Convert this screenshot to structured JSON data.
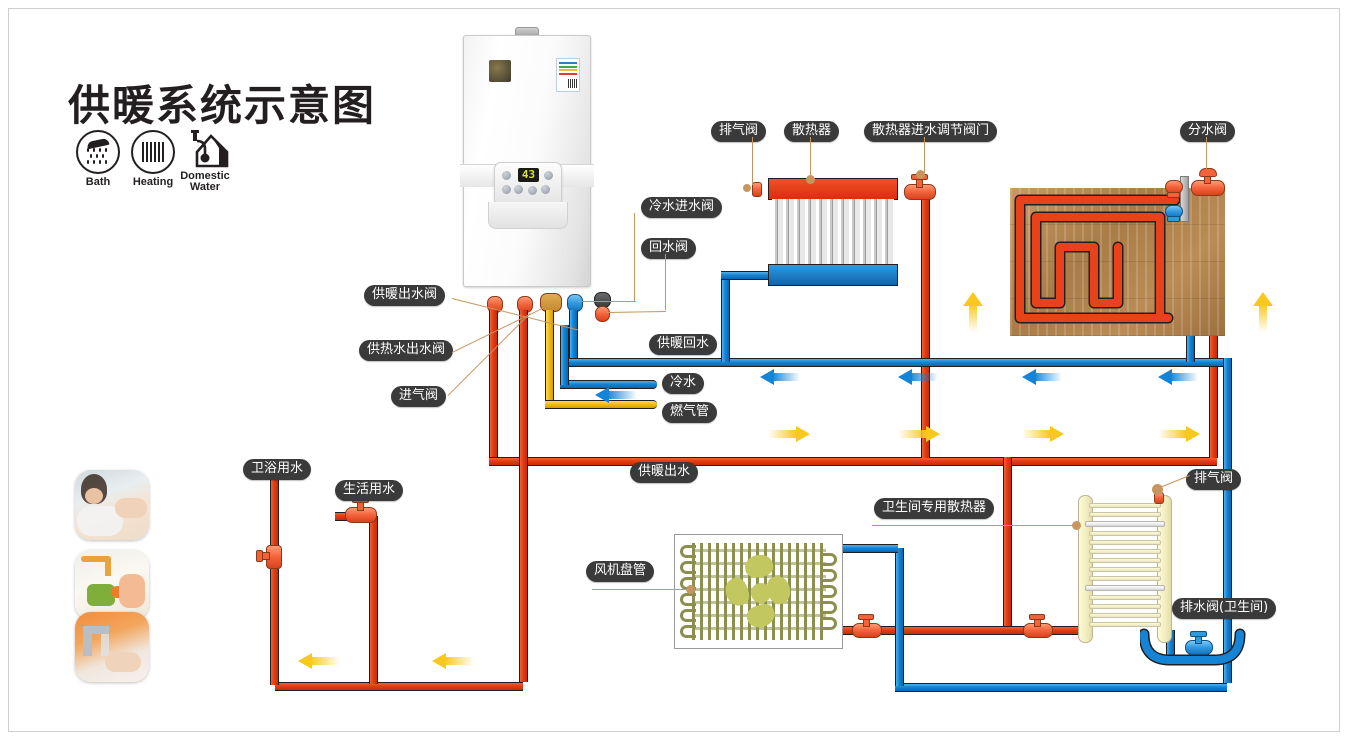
{
  "page": {
    "title": "供暖系统示意图"
  },
  "legend": {
    "items": [
      {
        "icon": "shower-icon",
        "label": "Bath"
      },
      {
        "icon": "radiator-icon",
        "label": "Heating"
      },
      {
        "icon": "house-tap-icon",
        "label": "Domestic\nWater",
        "line1": "Domestic",
        "line2": "Water"
      }
    ]
  },
  "photos": [
    {
      "name": "photo-bathing",
      "alt": "bathing"
    },
    {
      "name": "photo-washing-vegetables",
      "alt": "washing vegetables"
    },
    {
      "name": "photo-washing-hands",
      "alt": "washing hands"
    }
  ],
  "boiler": {
    "name": "wall-hung-gas-boiler",
    "display_value": "43"
  },
  "labels": {
    "cold_water_inlet_valve": "冷水进水阀",
    "return_water_valve": "回水阀",
    "heating_outlet_valve": "供暖出水阀",
    "hot_water_outlet_valve": "供热水出水阀",
    "gas_inlet_valve": "进气阀",
    "heating_return": "供暖回水",
    "cold_water": "冷水",
    "gas_pipe": "燃气管",
    "heating_supply": "供暖出水",
    "air_vent_valve_radiator": "排气阀",
    "radiator": "散热器",
    "radiator_inlet_regulating_valve": "散热器进水调节阀门",
    "manifold_valve": "分水阀",
    "bath_water": "卫浴用水",
    "domestic_water": "生活用水",
    "fan_coil_unit": "风机盘管",
    "bathroom_dedicated_radiator": "卫生间专用散热器",
    "air_vent_valve_towel": "排气阀",
    "drain_valve_bathroom": "排水阀(卫生间)"
  },
  "colors": {
    "hot_supply_red": "#e23c12",
    "return_blue": "#1484d6",
    "gas_yellow": "#f5bc16",
    "label_pill": "#3a3a3a",
    "leader_line": "#c8955f",
    "arrow_yellow": "#f9c81e",
    "arrow_blue": "#1484d6",
    "wood_floor": "#a97c48",
    "towel_radiator": "#f3efc2",
    "fan_coil_green": "#8d8f4e"
  },
  "flow_arrows": {
    "blue_left_row": 4,
    "yellow_right_row": 4,
    "yellow_up": 2,
    "yellow_left_bottom": 2
  }
}
